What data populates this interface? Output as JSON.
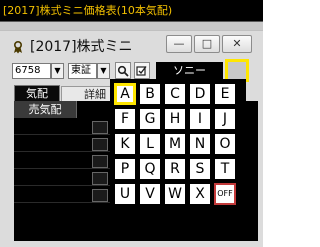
{
  "outer_window": {
    "title": "[2017]株式ミニ価格表(10本気配)"
  },
  "inner_window": {
    "title": "[2017]株式ミニ",
    "icon": "ribbon-icon",
    "controls": {
      "minimize": "—",
      "maximize": "□",
      "close": "✕"
    }
  },
  "toolbar": {
    "code": "6758",
    "market": "東証",
    "dropdown_glyph": "▼",
    "search_glyph": "🔍",
    "edit_glyph": "☑",
    "stock_name": "ソニー"
  },
  "tabs": [
    {
      "label": "気配"
    },
    {
      "label": "詳細"
    }
  ],
  "board": {
    "header": "売気配"
  },
  "letter_picker": {
    "keys": [
      "A",
      "B",
      "C",
      "D",
      "E",
      "F",
      "G",
      "H",
      "I",
      "J",
      "K",
      "L",
      "M",
      "N",
      "O",
      "P",
      "Q",
      "R",
      "S",
      "T",
      "U",
      "V",
      "W",
      "X",
      "OFF"
    ],
    "selected": "A"
  },
  "colors": {
    "accent_yellow": "#ffe600",
    "title_text": "#f3c000",
    "off_border": "#c23a3a"
  }
}
